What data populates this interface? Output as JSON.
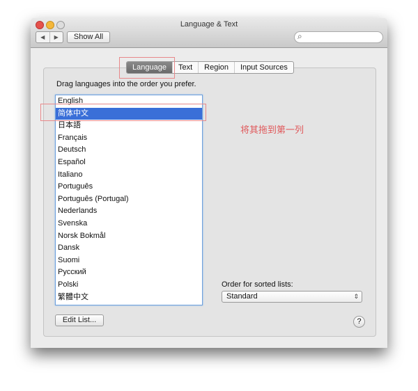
{
  "window": {
    "title": "Language & Text"
  },
  "toolbar": {
    "back": "◀",
    "forward": "▶",
    "show_all": "Show All",
    "search_icon": "⌕",
    "search_placeholder": ""
  },
  "tabs": [
    "Language",
    "Text",
    "Region",
    "Input Sources"
  ],
  "language": {
    "instruction": "Drag languages into the order you prefer.",
    "languages": [
      "English",
      "简体中文",
      "日本語",
      "Français",
      "Deutsch",
      "Español",
      "Italiano",
      "Português",
      "Português (Portugal)",
      "Nederlands",
      "Svenska",
      "Norsk Bokmål",
      "Dansk",
      "Suomi",
      "Русский",
      "Polski",
      "繁體中文"
    ],
    "selected_index": 1,
    "annotation": "将其拖到第一列",
    "edit_list": "Edit List...",
    "sort_label": "Order for sorted lists:",
    "sort_value": "Standard",
    "sort_arrows": "⇕",
    "help": "?"
  },
  "colors": {
    "selection": "#3a6fd8",
    "annotation": "#e0595b"
  }
}
